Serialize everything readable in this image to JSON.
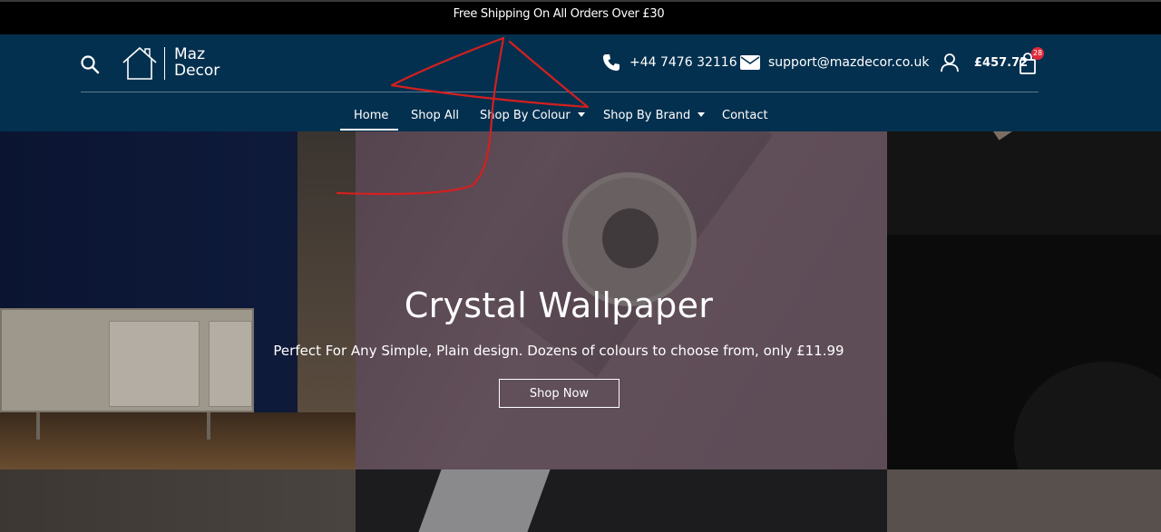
{
  "topbar": {
    "announcement": "Free Shipping On All Orders Over £30"
  },
  "header": {
    "logo": {
      "line1": "Maz",
      "line2": "Decor"
    },
    "phone": "+44 7476 32116",
    "email": "support@mazdecor.co.uk",
    "cart_total": "£457.72",
    "cart_count": "28"
  },
  "nav": {
    "items": [
      {
        "label": "Home",
        "active": true
      },
      {
        "label": "Shop All"
      },
      {
        "label": "Shop By Colour",
        "dropdown": true
      },
      {
        "label": "Shop By Brand",
        "dropdown": true
      },
      {
        "label": "Contact"
      }
    ]
  },
  "hero": {
    "title": "Crystal Wallpaper",
    "subtitle": "Perfect For Any Simple, Plain design. Dozens of colours to choose from, only £11.99",
    "cta": "Shop Now"
  },
  "colors": {
    "header_bg": "#04304f",
    "topbar_bg": "#000000",
    "badge": "#e0283a",
    "annotation_stroke": "#d41f1f"
  },
  "icons": [
    "search-icon",
    "house-logo-icon",
    "phone-icon",
    "mail-icon",
    "user-icon",
    "shopping-bag-icon",
    "chevron-down-icon"
  ]
}
